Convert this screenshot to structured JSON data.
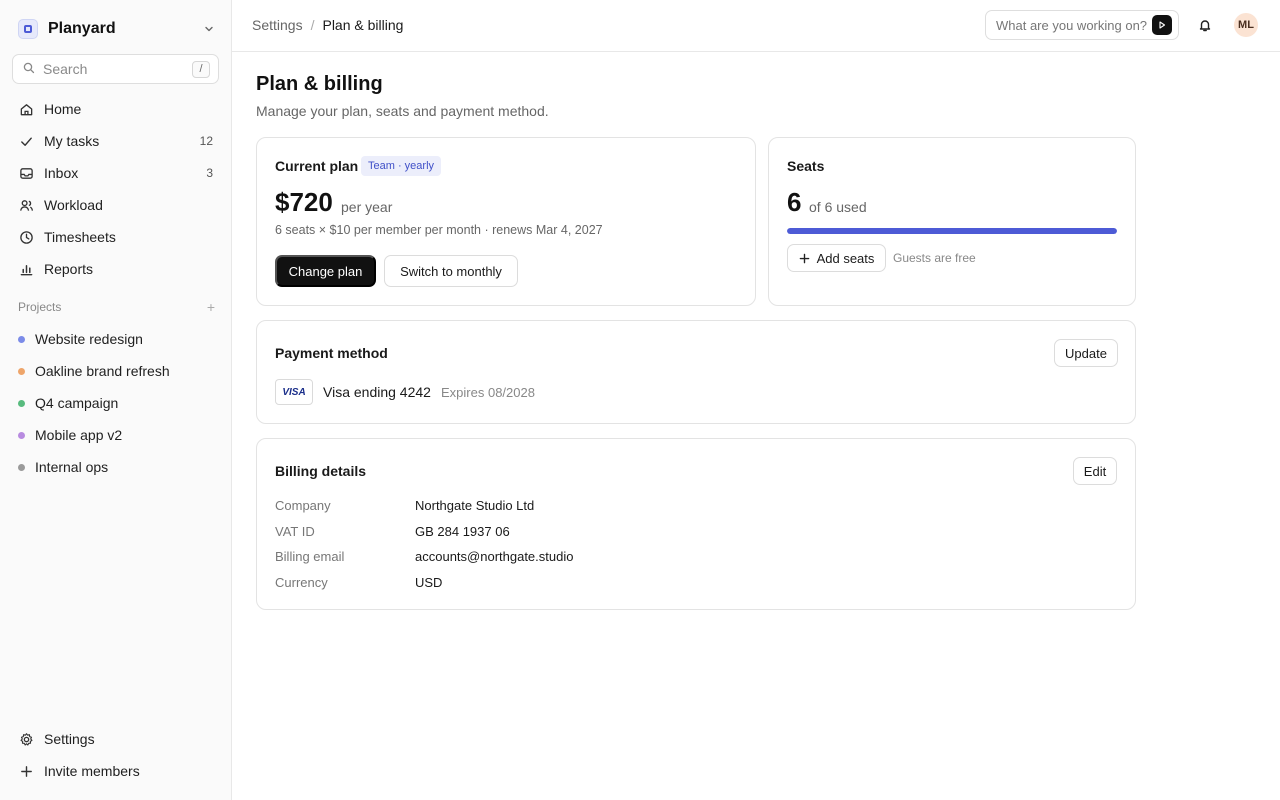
{
  "workspace": {
    "name": "Planyard"
  },
  "search": {
    "placeholder": "Search",
    "shortcut": "/"
  },
  "nav": {
    "items": [
      {
        "label": "Home",
        "icon": "home-icon",
        "count": ""
      },
      {
        "label": "My tasks",
        "icon": "check-icon",
        "count": "12"
      },
      {
        "label": "Inbox",
        "icon": "inbox-icon",
        "count": "3"
      },
      {
        "label": "Workload",
        "icon": "users-icon",
        "count": ""
      },
      {
        "label": "Timesheets",
        "icon": "clock-icon",
        "count": ""
      },
      {
        "label": "Reports",
        "icon": "bar-chart-icon",
        "count": ""
      }
    ]
  },
  "projects": {
    "heading": "Projects",
    "items": [
      {
        "label": "Website redesign",
        "color": "#7b8be8"
      },
      {
        "label": "Oakline brand refresh",
        "color": "#eea56a"
      },
      {
        "label": "Q4 campaign",
        "color": "#58bb7e"
      },
      {
        "label": "Mobile app v2",
        "color": "#b88be0"
      },
      {
        "label": "Internal ops",
        "color": "#9a9a9a"
      }
    ]
  },
  "bottom_nav": {
    "settings": "Settings",
    "invite": "Invite members"
  },
  "breadcrumb": {
    "parent": "Settings",
    "separator": "/",
    "current": "Plan & billing"
  },
  "ask": {
    "placeholder": "What are you working on?"
  },
  "user": {
    "initials": "ML"
  },
  "page": {
    "title": "Plan & billing",
    "subtitle": "Manage your plan, seats and payment method."
  },
  "plan": {
    "title": "Current plan",
    "badge": "Team · yearly",
    "price": "$720",
    "period": "per year",
    "detail": "6 seats × $10 per member per month · renews Mar 4, 2027",
    "change_label": "Change plan",
    "switch_label": "Switch to monthly"
  },
  "seats": {
    "title": "Seats",
    "used": "6",
    "of_text": "of 6 used",
    "fraction_used": 1.0,
    "add_label": "Add seats",
    "note": "Guests are free"
  },
  "payment": {
    "title": "Payment method",
    "update_label": "Update",
    "brand": "VISA",
    "card_text": "Visa ending 4242",
    "expiry": "Expires 08/2028"
  },
  "billing": {
    "title": "Billing details",
    "edit_label": "Edit",
    "fields": [
      {
        "key": "Company",
        "value": "Northgate Studio Ltd"
      },
      {
        "key": "VAT ID",
        "value": "GB 284 1937 06"
      },
      {
        "key": "Billing email",
        "value": "accounts@northgate.studio"
      },
      {
        "key": "Currency",
        "value": "USD"
      }
    ]
  },
  "colors": {
    "accent": "#4d5bd6",
    "primary_button": "#111111"
  }
}
